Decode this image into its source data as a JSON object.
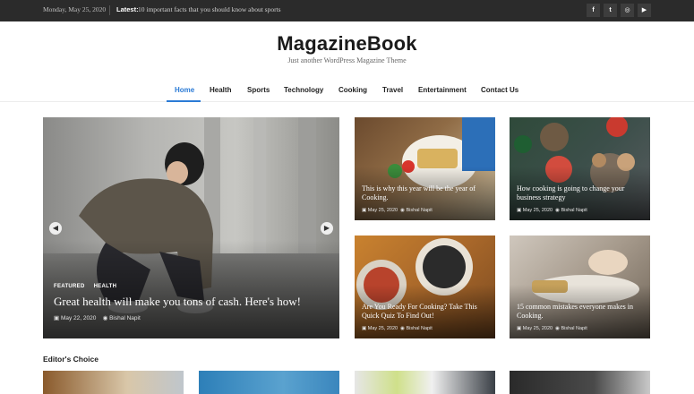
{
  "topbar": {
    "date": "Monday, May 25, 2020",
    "latest_label": "Latest:",
    "ticker": "10 important facts that you should know about sports",
    "social": [
      {
        "name": "facebook-icon",
        "glyph": "f"
      },
      {
        "name": "twitter-icon",
        "glyph": "t"
      },
      {
        "name": "instagram-icon",
        "glyph": "◎"
      },
      {
        "name": "youtube-icon",
        "glyph": "▶"
      }
    ]
  },
  "site": {
    "title": "MagazineBook",
    "tagline": "Just another WordPress Magazine Theme"
  },
  "nav": {
    "items": [
      "Home",
      "Health",
      "Sports",
      "Technology",
      "Cooking",
      "Travel",
      "Entertainment",
      "Contact Us"
    ],
    "active": "Home"
  },
  "hero": {
    "categories": [
      "FEATURED",
      "HEALTH"
    ],
    "title": "Great health will make you tons of cash. Here's how!",
    "date": "May 22, 2020",
    "author": "Bishal Napit",
    "prev_icon": "chevron-left-icon",
    "next_icon": "chevron-right-icon"
  },
  "cards": [
    {
      "title": "This is why this year will be the year of Cooking.",
      "date": "May 25, 2020",
      "author": "Bishal Napit"
    },
    {
      "title": "How cooking is going to change your business strategy",
      "date": "May 25, 2020",
      "author": "Bishal Napit"
    },
    {
      "title": "Are You Ready For Cooking? Take This Quick Quiz To Find Out!",
      "date": "May 25, 2020",
      "author": "Bishal Napit"
    },
    {
      "title": "15 common mistakes everyone makes in Cooking.",
      "date": "May 25, 2020",
      "author": "Bishal Napit"
    }
  ],
  "editors_choice": {
    "heading": "Editor's Choice"
  },
  "colors": {
    "accent": "#2b7bd6",
    "topbar": "#2b2b2b"
  }
}
